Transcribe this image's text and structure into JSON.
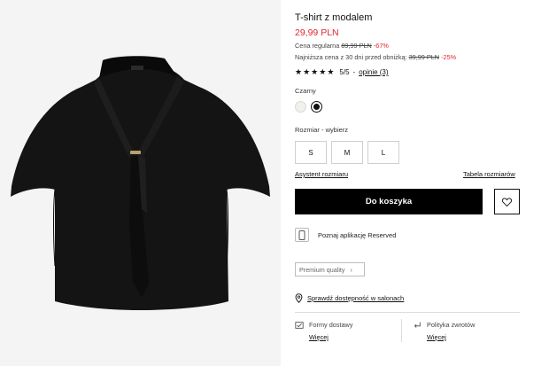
{
  "product": {
    "title": "T-shirt z modalem",
    "price": "29,99 PLN",
    "regular_label": "Cena regularna",
    "regular_price": "89,99 PLN",
    "regular_discount": "-67%",
    "lowest_label": "Najniższa cena z 30 dni przed obniżką:",
    "lowest_price": "39,99 PLN",
    "lowest_discount": "-25%"
  },
  "rating": {
    "stars": 5,
    "score": "5/5",
    "separator": "-",
    "reviews_link": "opinie (3)"
  },
  "color": {
    "label": "Czarny",
    "swatches": [
      {
        "name": "white",
        "hex": "#f2f0ec"
      },
      {
        "name": "black",
        "hex": "#111111",
        "selected": true
      }
    ]
  },
  "size": {
    "label": "Rozmiar -",
    "choose": "wybierz",
    "options": [
      "S",
      "M",
      "L"
    ],
    "assistant_link": "Asystent rozmiaru",
    "table_link": "Tabela rozmiarów"
  },
  "actions": {
    "add_to_cart": "Do koszyka"
  },
  "app_promo": "Poznaj aplikację Reserved",
  "premium_badge": "Premium quality",
  "stores_link": "Sprawdź dostępność w salonach",
  "info": {
    "delivery_title": "Formy dostawy",
    "delivery_more": "Więcej",
    "returns_title": "Polityka zwrotów",
    "returns_more": "Więcej"
  },
  "colors": {
    "accent_red": "#e3242b",
    "button_black": "#000000"
  }
}
